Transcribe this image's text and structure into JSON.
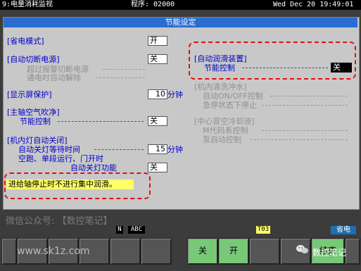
{
  "topbar": {
    "title": "9:电量消耗监视",
    "program": "程序: 02000",
    "datetime": "Wed Dec 20 19:49:01"
  },
  "panel": {
    "title": "节能设定"
  },
  "left": {
    "power_save_mode": {
      "label": "[省电模式]",
      "value": "开"
    },
    "auto_power_off": {
      "label": "[自动切断电源]",
      "value": "关",
      "sub1": "超过报警切断电源",
      "sub2": "通电时自动解除"
    },
    "screen_protect": {
      "label": "[显示屏保护]",
      "value": "10",
      "unit": "分钟"
    },
    "spindle_air": {
      "label": "[主轴空气吹净]",
      "sub": "节能控制",
      "value": "关"
    },
    "light_auto_off": {
      "label": "[机内灯自动关闭]",
      "sub1": "自动关灯等待时间",
      "value1": "15",
      "unit1": "分钟",
      "sub2": "空跑、单段运行、门开时",
      "sub3": "自动关灯功能",
      "value2": "关"
    }
  },
  "right": {
    "auto_lube": {
      "label": "[自动润滑装置]",
      "sub": "节能控制",
      "value": "关"
    },
    "coolant": {
      "label": "[机内清洗冲水]",
      "sub1": "自动ON/OFF控制",
      "sub2": "急停状态下停止"
    },
    "center_coolant": {
      "label": "[中心冒空冷却液]",
      "sub1": "M代码系控制",
      "sub2": "泵自动控制"
    }
  },
  "message": "进给轴停止时不进行集中润滑。",
  "watermark": "微信公众号: 【数控笔记】",
  "status": {
    "mode": "N",
    "abc": "ABC",
    "tool": "T03",
    "power_save": "省电"
  },
  "softkeys": {
    "off_label": "关",
    "on_label": "开",
    "end_label": "结束",
    "site_watermark": "www.sk1z.com",
    "brand_watermark": "数控笔记"
  },
  "colors": {
    "label_blue": "#0000cc",
    "title_blue": "#2a6ccf",
    "highlight_red": "#e01010",
    "message_yellow": "#ffff66",
    "softkey_green": "#78c878"
  }
}
